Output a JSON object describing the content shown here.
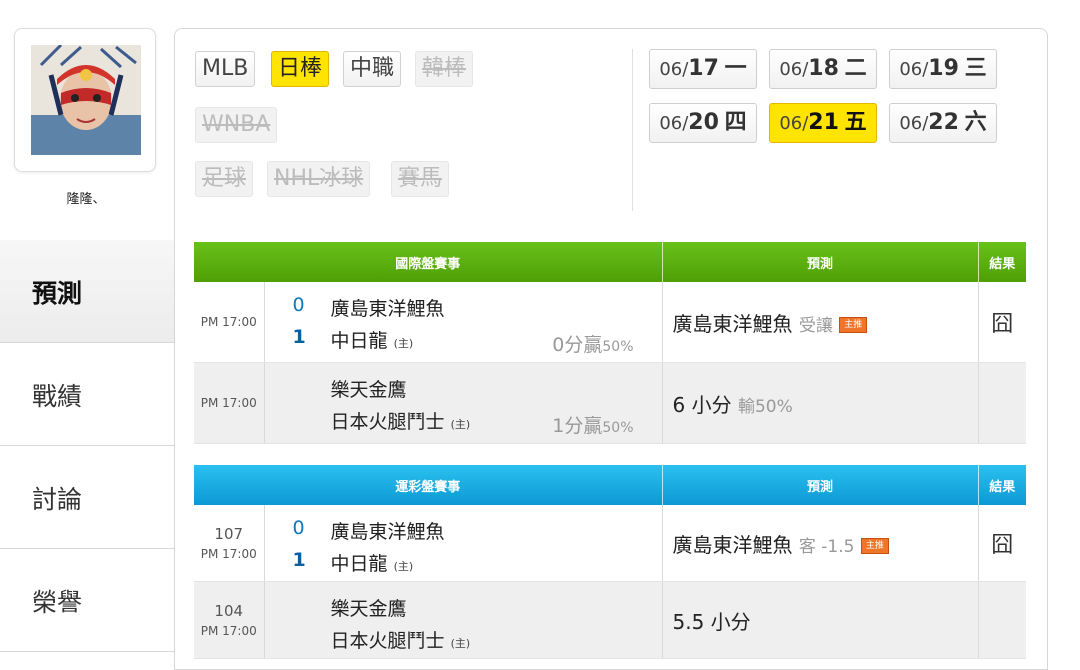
{
  "profile": {
    "username": "隆隆、"
  },
  "side_nav": [
    {
      "label": "預測",
      "active": true
    },
    {
      "label": "戰績",
      "active": false
    },
    {
      "label": "討論",
      "active": false
    },
    {
      "label": "榮譽",
      "active": false
    }
  ],
  "sport_tabs": [
    {
      "label": "MLB",
      "state": "normal"
    },
    {
      "label": "日棒",
      "state": "active"
    },
    {
      "label": "中職",
      "state": "normal"
    },
    {
      "label": "韓棒",
      "state": "disabled"
    },
    {
      "label": "WNBA",
      "state": "disabled"
    },
    {
      "label": "足球",
      "state": "disabled"
    },
    {
      "label": "NHL冰球",
      "state": "disabled"
    },
    {
      "label": "賽馬",
      "state": "disabled"
    }
  ],
  "date_tabs": [
    {
      "month": "06/",
      "day": "17",
      "weekday": "一",
      "active": false
    },
    {
      "month": "06/",
      "day": "18",
      "weekday": "二",
      "active": false
    },
    {
      "month": "06/",
      "day": "19",
      "weekday": "三",
      "active": false
    },
    {
      "month": "06/",
      "day": "20",
      "weekday": "四",
      "active": false
    },
    {
      "month": "06/",
      "day": "21",
      "weekday": "五",
      "active": true
    },
    {
      "month": "06/",
      "day": "22",
      "weekday": "六",
      "active": false
    }
  ],
  "intl_table": {
    "headers": {
      "event": "國際盤賽事",
      "prediction": "預測",
      "result": "結果"
    },
    "rows": [
      {
        "time": "PM 17:00",
        "score1": "0",
        "team1": "廣島東洋鯉魚",
        "score2": "1",
        "team2": "中日龍",
        "home_tag": "(主)",
        "odds": "0分贏",
        "odds_pct": "50%",
        "pick": "廣島東洋鯉魚",
        "pick_sub": "受讓",
        "badge": "主推",
        "result": "囧"
      },
      {
        "time": "PM 17:00",
        "team1": "樂天金鷹",
        "team2": "日本火腿鬥士",
        "home_tag": "(主)",
        "odds": "1分贏",
        "odds_pct": "50%",
        "pick": "6 小分",
        "pick_sub": "輸50%",
        "result": ""
      }
    ]
  },
  "sport_table": {
    "headers": {
      "event": "運彩盤賽事",
      "prediction": "預測",
      "result": "結果"
    },
    "rows": [
      {
        "num": "107",
        "time": "PM 17:00",
        "score1": "0",
        "team1": "廣島東洋鯉魚",
        "score2": "1",
        "team2": "中日龍",
        "home_tag": "(主)",
        "pick": "廣島東洋鯉魚",
        "pick_sub": "客 -1.5",
        "badge": "主推",
        "result": "囧"
      },
      {
        "num": "104",
        "time": "PM 17:00",
        "team1": "樂天金鷹",
        "team2": "日本火腿鬥士",
        "home_tag": "(主)",
        "pick": "5.5 小分",
        "result": ""
      }
    ]
  },
  "colors": {
    "active_tab": "#ffe400",
    "intl_header": "#58ad0c",
    "sport_header": "#1aa9e0",
    "badge": "#f0752a",
    "score": "#1177bb"
  },
  "icons": {
    "avatar": "avatar-portrait-image"
  }
}
